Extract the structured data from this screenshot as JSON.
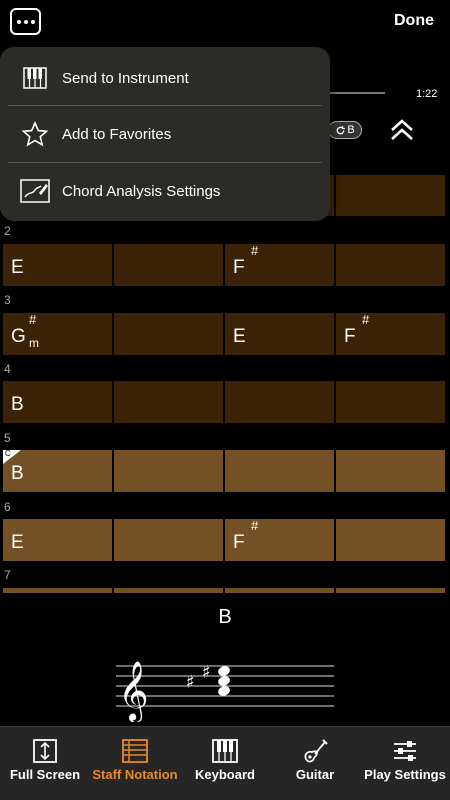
{
  "header": {
    "done_label": "Done"
  },
  "playback": {
    "time": "1:22",
    "key_button": "B"
  },
  "menu": {
    "items": [
      {
        "label": "Send to Instrument",
        "icon": "keyboard-icon"
      },
      {
        "label": "Add to Favorites",
        "icon": "star-icon"
      },
      {
        "label": "Chord Analysis Settings",
        "icon": "chord-settings-icon"
      }
    ]
  },
  "grid": {
    "rows": [
      {
        "number": "",
        "cells": [
          {
            "chord": ""
          },
          {
            "chord": ""
          },
          {
            "chord": ""
          },
          {
            "chord": ""
          }
        ]
      },
      {
        "number": "2",
        "cells": [
          {
            "chord": "E"
          },
          {
            "chord": ""
          },
          {
            "chord": "F",
            "sup": "#"
          },
          {
            "chord": ""
          }
        ]
      },
      {
        "number": "3",
        "cells": [
          {
            "chord": "G",
            "sup": "#",
            "sub": "m"
          },
          {
            "chord": ""
          },
          {
            "chord": "E"
          },
          {
            "chord": "F",
            "sup": "#"
          }
        ]
      },
      {
        "number": "4",
        "cells": [
          {
            "chord": "B"
          },
          {
            "chord": ""
          },
          {
            "chord": ""
          },
          {
            "chord": ""
          }
        ]
      },
      {
        "number": "5",
        "cells": [
          {
            "chord": "B",
            "marker": "C"
          },
          {
            "chord": ""
          },
          {
            "chord": ""
          },
          {
            "chord": ""
          }
        ]
      },
      {
        "number": "6",
        "cells": [
          {
            "chord": "E"
          },
          {
            "chord": ""
          },
          {
            "chord": "F",
            "sup": "#"
          },
          {
            "chord": ""
          }
        ]
      },
      {
        "number": "7",
        "cells": []
      }
    ]
  },
  "current_chord": {
    "name": "B"
  },
  "tabs": [
    {
      "label": "Full Screen",
      "icon": "full-screen-icon",
      "active": false
    },
    {
      "label": "Staff Notation",
      "icon": "staff-notation-icon",
      "active": true
    },
    {
      "label": "Keyboard",
      "icon": "keyboard-icon",
      "active": false
    },
    {
      "label": "Guitar",
      "icon": "guitar-icon",
      "active": false
    },
    {
      "label": "Play Settings",
      "icon": "sliders-icon",
      "active": false
    }
  ],
  "colors": {
    "accent": "#e8892a",
    "cell_dark": "#3c2307",
    "cell_light": "#745125",
    "menu_bg": "#2b2b27"
  }
}
